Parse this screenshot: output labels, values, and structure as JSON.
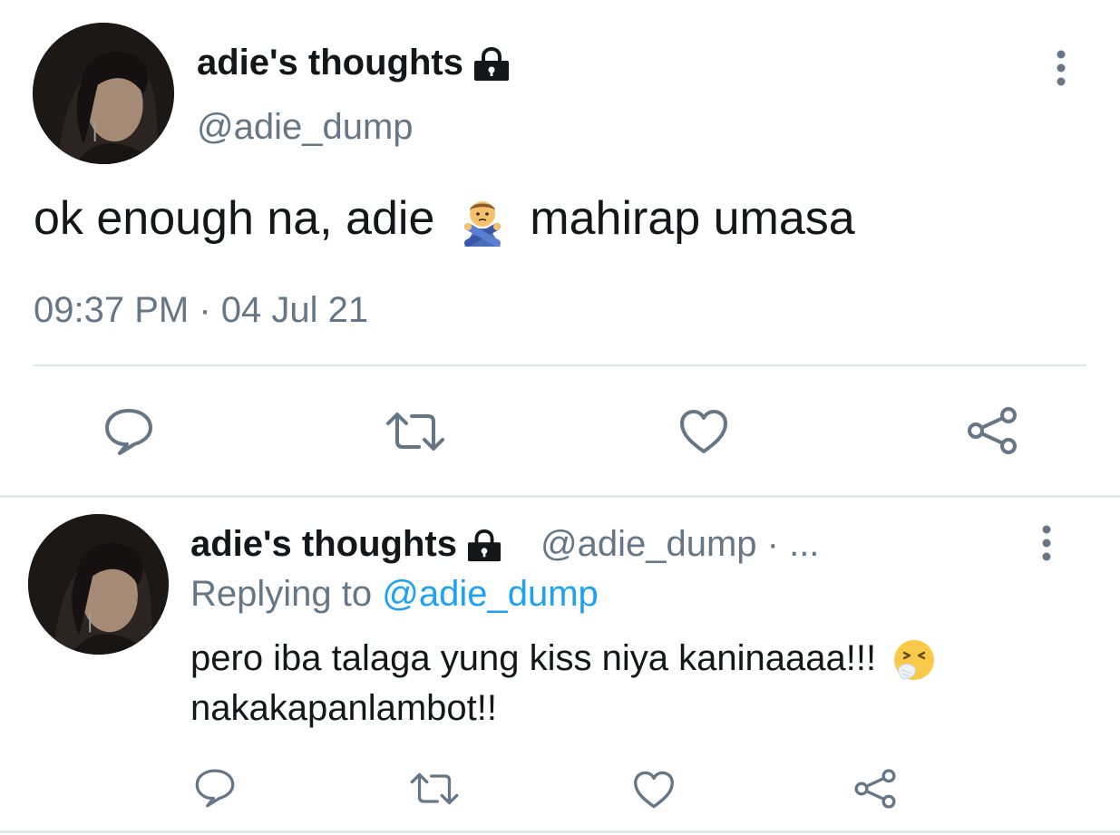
{
  "main_tweet": {
    "display_name": "adie's thoughts",
    "handle": "@adie_dump",
    "text_before": "ok enough na, adie",
    "emoji": "person-gesturing-no-emoji",
    "text_after": "mahirap umasa",
    "timestamp": "09:37 PM · 04 Jul 21"
  },
  "reply_tweet": {
    "display_name": "adie's thoughts",
    "handle_meta": "@adie_dump · ...",
    "replying_prefix": "Replying to",
    "replying_handle": "@adie_dump",
    "text_line1": "pero iba talaga yung kiss niya kaninaaaa!!!",
    "emoji": "sneezing-face-emoji",
    "text_line2": "nakakapanlambot!!"
  },
  "actions": [
    "reply",
    "retweet",
    "like",
    "share"
  ],
  "colors": {
    "text": "#14171a",
    "secondary": "#657786",
    "link": "#1da1f2",
    "divider": "#e1e8ed",
    "icon": "#657786"
  }
}
